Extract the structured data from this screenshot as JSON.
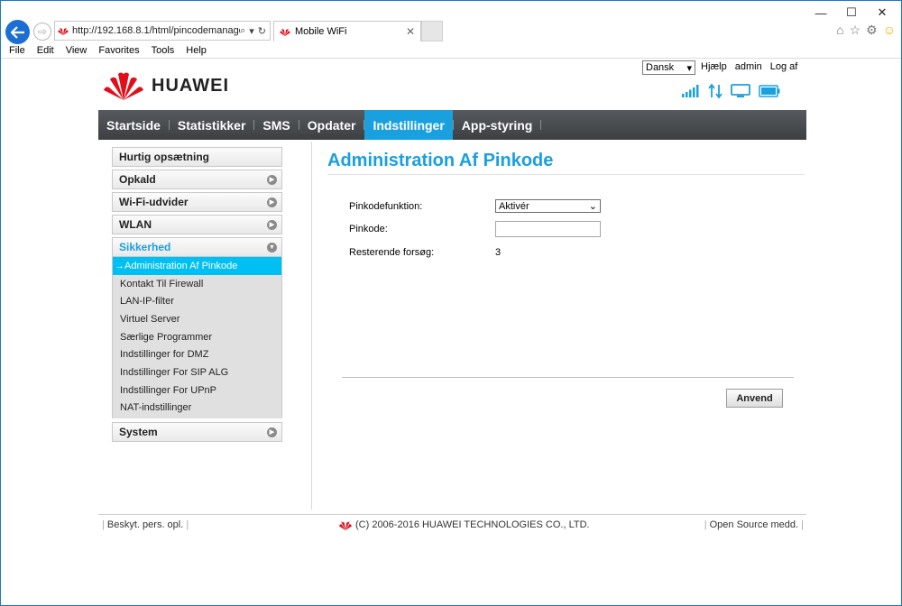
{
  "browser": {
    "address": "http://192.168.8.1/html/pincodemanage",
    "tab_title": "Mobile WiFi",
    "menu": [
      "File",
      "Edit",
      "View",
      "Favorites",
      "Tools",
      "Help"
    ]
  },
  "header": {
    "brand": "HUAWEI",
    "language": "Dansk",
    "links": {
      "help": "Hjælp",
      "user": "admin",
      "logout": "Log af"
    }
  },
  "nav": {
    "items": [
      {
        "label": "Startside"
      },
      {
        "label": "Statistikker"
      },
      {
        "label": "SMS"
      },
      {
        "label": "Opdater"
      },
      {
        "label": "Indstillinger"
      },
      {
        "label": "App-styring"
      }
    ],
    "active": "Indstillinger"
  },
  "sidebar": {
    "quick_setup": "Hurtig opsætning",
    "call": "Opkald",
    "wifi_extender": "Wi-Fi-udvider",
    "wlan": "WLAN",
    "security": "Sikkerhed",
    "security_items": [
      {
        "label": "→Administration Af Pinkode"
      },
      {
        "label": "Kontakt Til Firewall"
      },
      {
        "label": "LAN-IP-filter"
      },
      {
        "label": "Virtuel Server"
      },
      {
        "label": "Særlige Programmer"
      },
      {
        "label": "Indstillinger for DMZ"
      },
      {
        "label": "Indstillinger For SIP ALG"
      },
      {
        "label": "Indstillinger For UPnP"
      },
      {
        "label": "NAT-indstillinger"
      }
    ],
    "system": "System"
  },
  "content": {
    "title": "Administration Af Pinkode",
    "pin_function_label": "Pinkodefunktion:",
    "pin_function_value": "Aktivér",
    "pin_label": "Pinkode:",
    "pin_value": "",
    "remaining_label": "Resterende forsøg:",
    "remaining_value": "3",
    "apply": "Anvend"
  },
  "footer": {
    "privacy": "Beskyt. pers. opl.",
    "copyright": "(C) 2006-2016 HUAWEI TECHNOLOGIES CO., LTD.",
    "open_source": "Open Source medd."
  },
  "colors": {
    "accent": "#1aa0de",
    "active_sub": "#00c0f3",
    "nav_bg": "#4a4d50",
    "brand_red": "#e0101b"
  }
}
